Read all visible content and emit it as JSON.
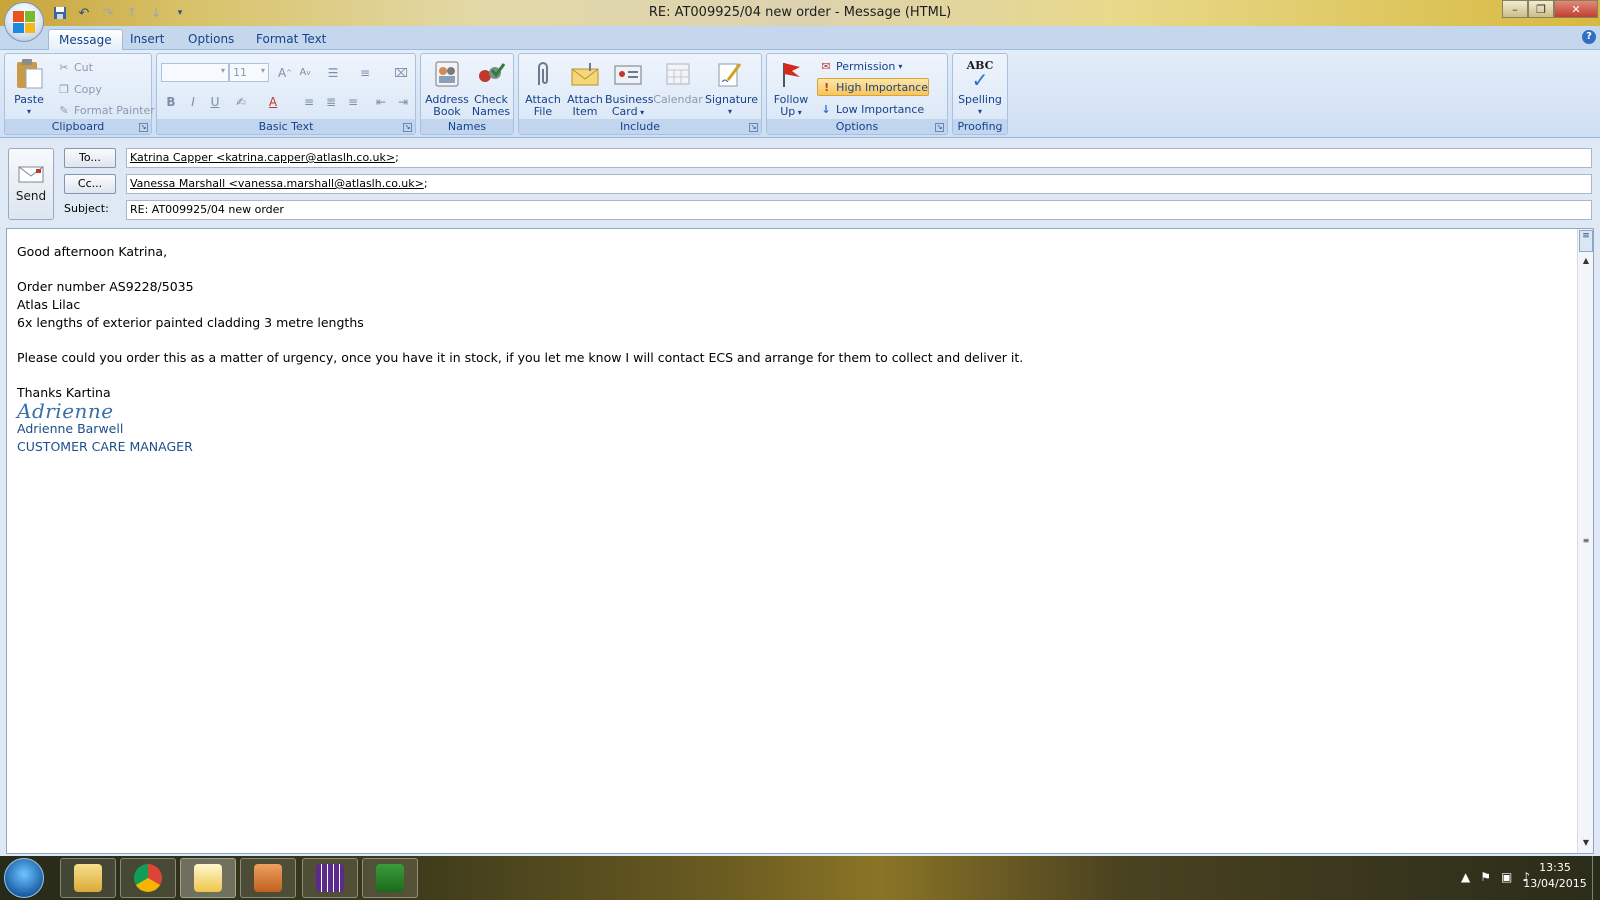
{
  "window": {
    "title": "RE: AT009925/04 new order - Message (HTML)"
  },
  "tabs": [
    {
      "label": "Message",
      "active": true
    },
    {
      "label": "Insert"
    },
    {
      "label": "Options"
    },
    {
      "label": "Format Text"
    }
  ],
  "ribbon": {
    "clipboard": {
      "label": "Clipboard",
      "paste": "Paste",
      "cut": "Cut",
      "copy": "Copy",
      "format_painter": "Format Painter"
    },
    "basic_text": {
      "label": "Basic Text",
      "font_size": "11"
    },
    "names": {
      "label": "Names",
      "address_book": [
        "Address",
        "Book"
      ],
      "check_names": [
        "Check",
        "Names"
      ]
    },
    "include": {
      "label": "Include",
      "attach_file": [
        "Attach",
        "File"
      ],
      "attach_item": [
        "Attach",
        "Item"
      ],
      "business_card": [
        "Business",
        "Card"
      ],
      "calendar": "Calendar",
      "signature": "Signature"
    },
    "options": {
      "label": "Options",
      "follow_up": [
        "Follow",
        "Up"
      ],
      "permission": "Permission",
      "high_importance": "High Importance",
      "low_importance": "Low Importance"
    },
    "proofing": {
      "label": "Proofing",
      "spelling": "Spelling",
      "abc": "ABC"
    }
  },
  "header": {
    "send_label": "Send",
    "to_button": "To...",
    "cc_button": "Cc...",
    "subject_label": "Subject:",
    "to_value": "Katrina Capper <katrina.capper@atlaslh.co.uk>",
    "cc_value": "Vanessa Marshall <vanessa.marshall@atlaslh.co.uk>",
    "separator": ";",
    "subject_value": "RE: AT009925/04 new order"
  },
  "message": {
    "greeting": "Good afternoon Katrina,",
    "order_number": "Order number AS9228/5035",
    "product": "Atlas Lilac",
    "quantity": "6x lengths of exterior painted cladding 3 metre lengths",
    "request": "Please could you order this as a matter of urgency, once you have it in stock, if you let me know I will contact ECS and arrange for them to collect  and deliver it.",
    "thanks": "Thanks Kartina",
    "signature_script": "Adrienne",
    "signature_name": "Adrienne Barwell",
    "signature_title": "CUSTOMER CARE MANAGER"
  },
  "taskbar": {
    "time": "13:35",
    "date": "13/04/2015"
  },
  "colors": {
    "ribbon_text": "#15428b",
    "high_importance_bg": "#f8c55a",
    "signature_blue": "#1f4e8c"
  }
}
